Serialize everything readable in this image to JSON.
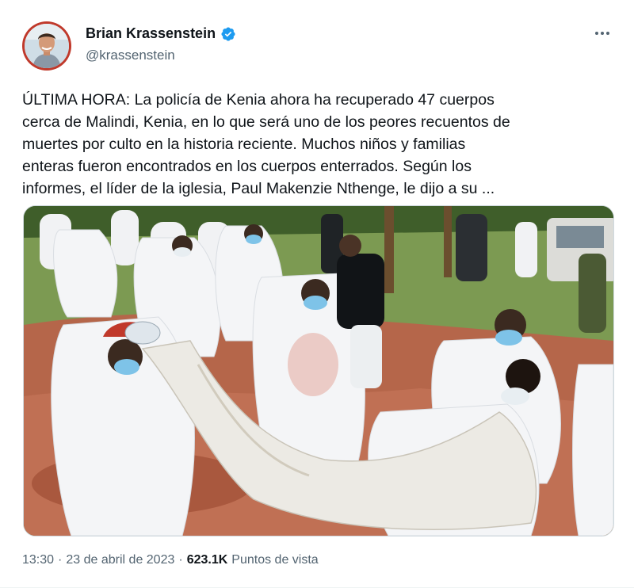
{
  "author": {
    "display_name": "Brian Krassenstein",
    "handle": "@krassenstein",
    "verified": true
  },
  "tweet": {
    "text": "ÚLTIMA HORA: La policía de Kenia ahora ha recuperado 47 cuerpos\ncerca de Malindi, Kenia, en lo que será uno de los peores recuentos de\nmuertes por culto en la historia reciente. Muchos niños y familias\nenteras fueron encontrados en los cuerpos enterrados. Según los\ninformes, el líder de la iglesia, Paul Makenzie Nthenge, le dijo a su ..."
  },
  "footer": {
    "time": "13:30",
    "separator": "·",
    "date": "23 de abril de 2023",
    "views_count": "623.1K",
    "views_label": "Puntos de vista"
  },
  "colors": {
    "text_primary": "#0f1419",
    "text_secondary": "#536471",
    "verified_blue": "#1d9bf0",
    "border": "#cfd9de"
  },
  "icons": {
    "more": "more-horizontal-icon",
    "verified": "verified-badge-icon"
  }
}
